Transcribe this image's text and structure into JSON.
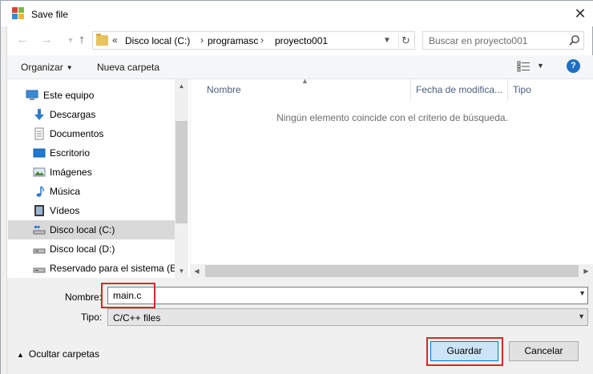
{
  "window": {
    "title": "Save file",
    "close_label": "✕"
  },
  "nav_buttons": {
    "back": "←",
    "forward": "→",
    "up": "↑"
  },
  "address": {
    "overflow": "«",
    "crumbs": [
      "Disco local (C:)",
      "programasc",
      "proyecto001"
    ],
    "separator": "›"
  },
  "search": {
    "placeholder": "Buscar en proyecto001"
  },
  "toolbar": {
    "organize_label": "Organizar",
    "new_folder_label": "Nueva carpeta",
    "help_label": "?"
  },
  "sidebar": {
    "items": [
      {
        "label": "Este equipo",
        "icon": "computer-icon"
      },
      {
        "label": "Descargas",
        "icon": "downloads-icon"
      },
      {
        "label": "Documentos",
        "icon": "documents-icon"
      },
      {
        "label": "Escritorio",
        "icon": "desktop-icon"
      },
      {
        "label": "Imágenes",
        "icon": "pictures-icon"
      },
      {
        "label": "Música",
        "icon": "music-icon"
      },
      {
        "label": "Vídeos",
        "icon": "videos-icon"
      },
      {
        "label": "Disco local (C:)",
        "icon": "drive-c-icon",
        "selected": true
      },
      {
        "label": "Disco local (D:)",
        "icon": "drive-icon"
      },
      {
        "label": "Reservado para el sistema (E:)",
        "icon": "drive-icon"
      }
    ]
  },
  "file_list": {
    "columns": [
      "Nombre",
      "Fecha de modifica...",
      "Tipo"
    ],
    "empty_message": "Ningún elemento coincide con el criterio de búsqueda."
  },
  "form": {
    "name_label": "Nombre:",
    "name_value": "main.c",
    "type_label": "Tipo:",
    "type_value": "C/C++ files"
  },
  "footer": {
    "hide_folders_label": "Ocultar carpetas",
    "save_label": "Guardar",
    "cancel_label": "Cancelar"
  },
  "colors": {
    "highlight": "#d42a2a",
    "accent": "#0078d7",
    "selection": "#d9d9d9"
  }
}
